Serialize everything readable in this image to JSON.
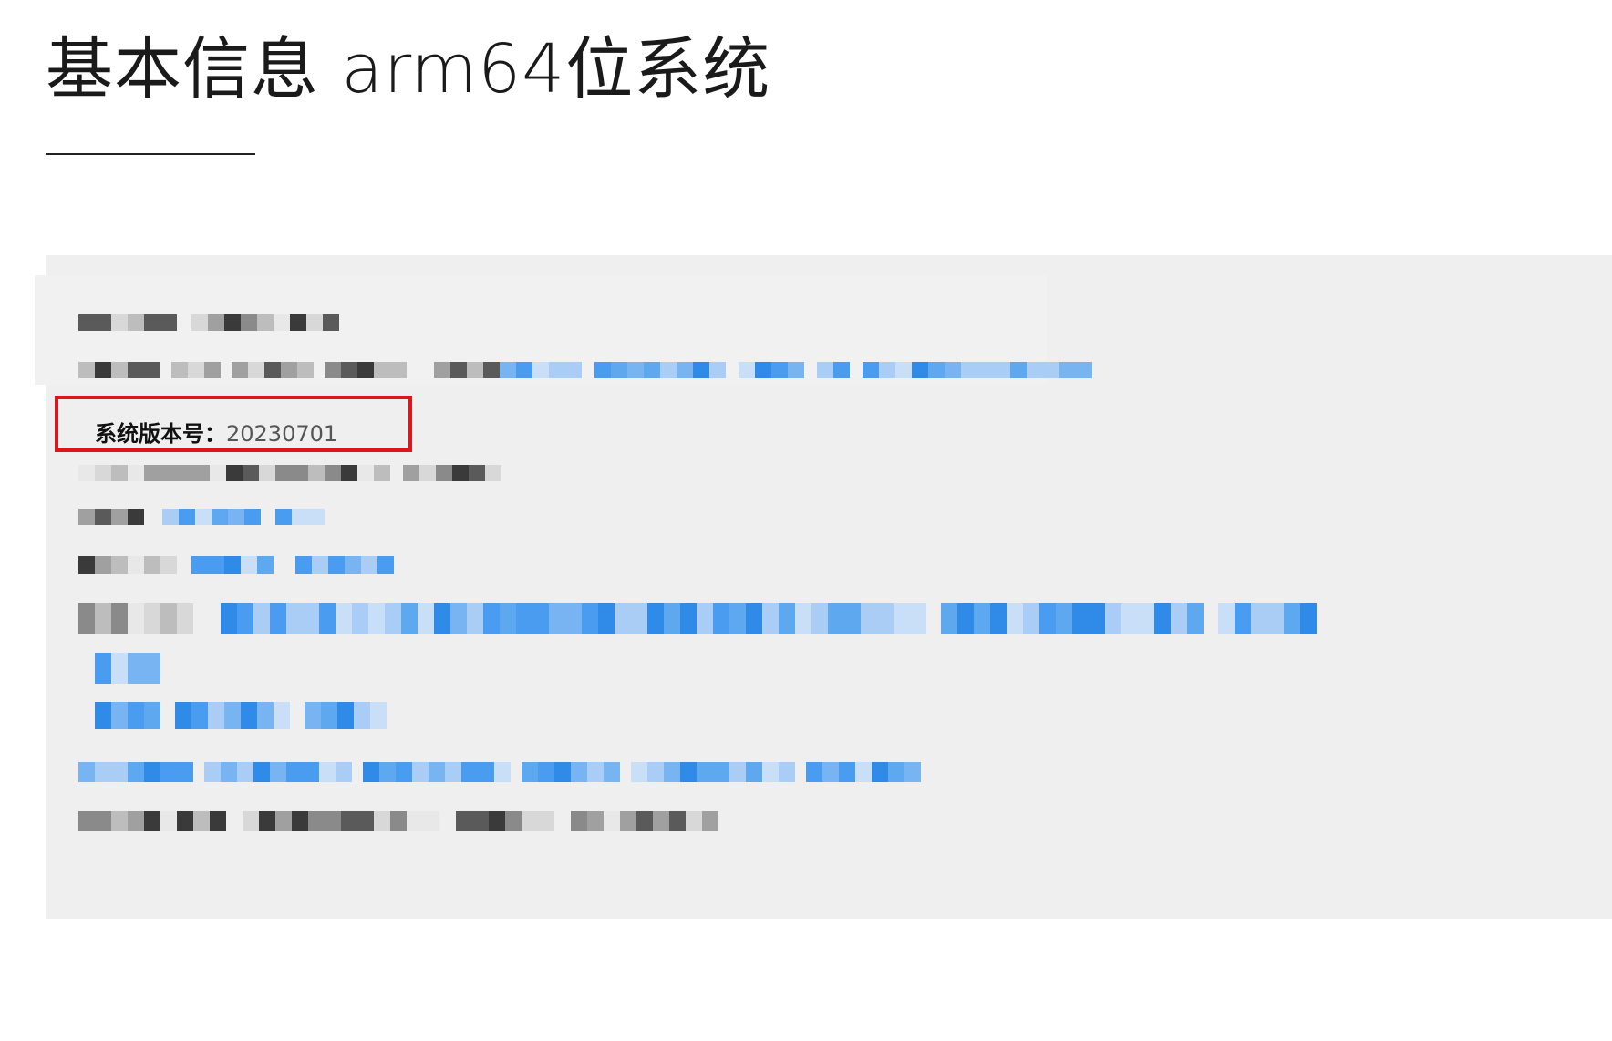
{
  "header": {
    "title": "基本信息 arm64位系统"
  },
  "info_panel": {
    "version": {
      "label": "系统版本号：",
      "value": "20230701"
    }
  },
  "colors": {
    "panel_bg": "#efefef",
    "highlight_border": "#e0141b",
    "link_blue": "#4a9cf0",
    "redacted_gray": "#555555"
  }
}
